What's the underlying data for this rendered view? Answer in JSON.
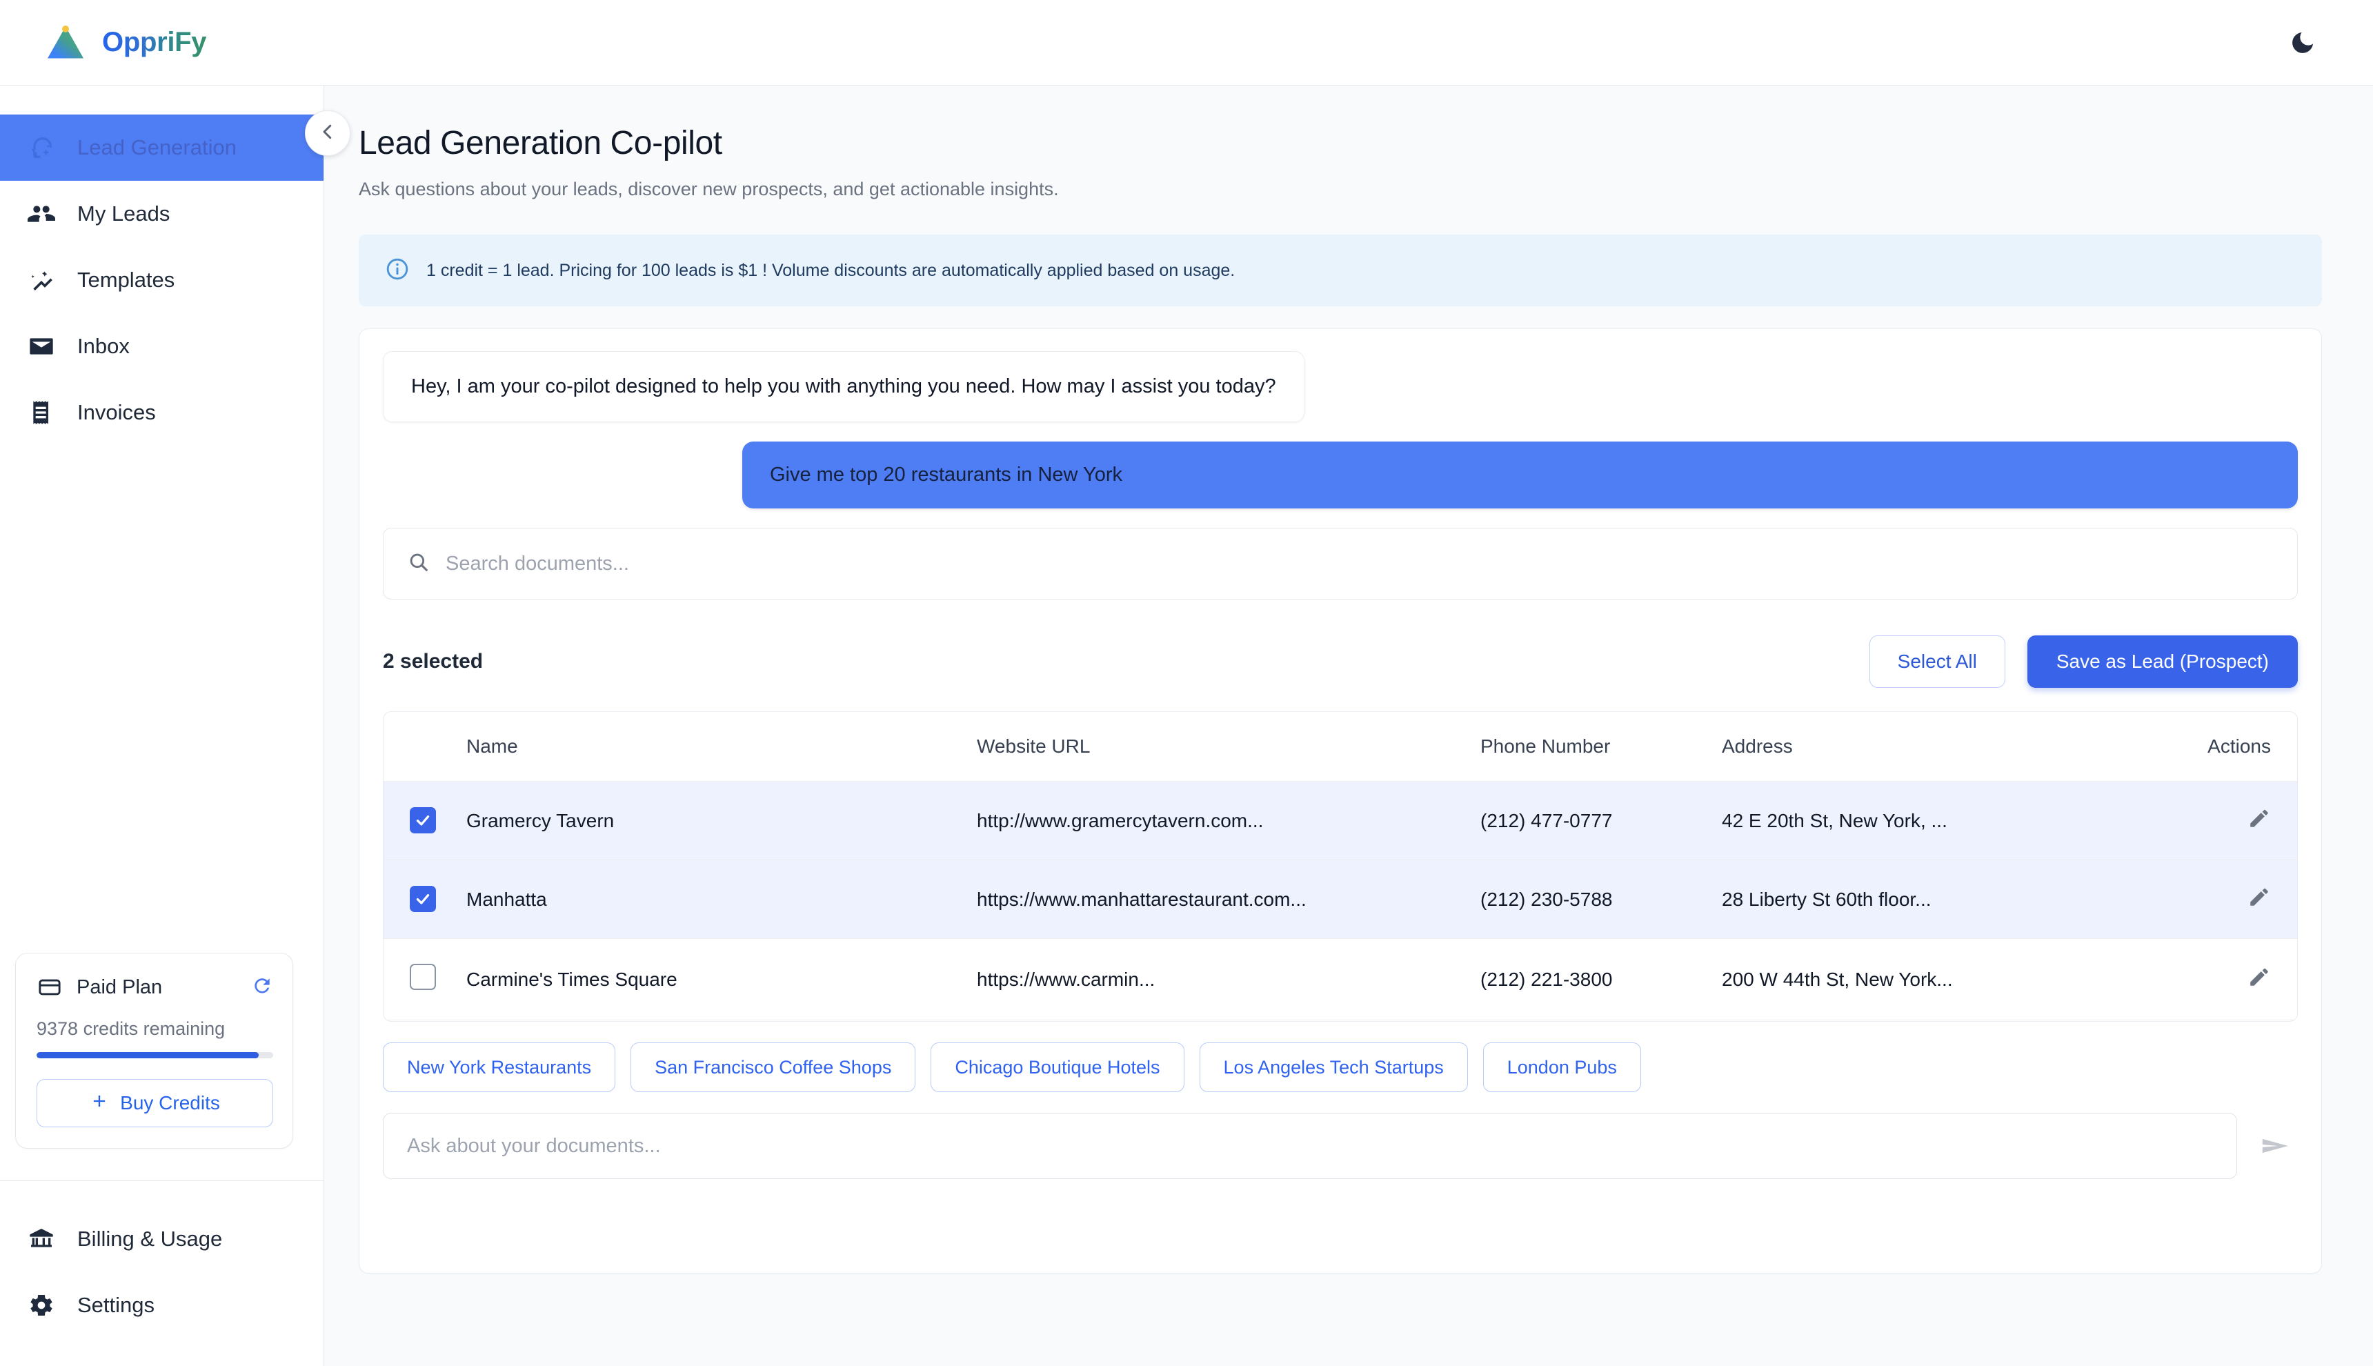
{
  "brand": {
    "name": "OppriFy",
    "logo_icon": "triangle-logo-icon"
  },
  "topbar": {
    "theme_toggle_icon": "moon-icon"
  },
  "sidebar": {
    "collapse_icon": "chevron-left-icon",
    "items": [
      {
        "label": "Lead Generation",
        "icon": "psychology-brain-icon",
        "active": true
      },
      {
        "label": "My Leads",
        "icon": "people-icon",
        "active": false
      },
      {
        "label": "Templates",
        "icon": "sparkle-chart-icon",
        "active": false
      },
      {
        "label": "Inbox",
        "icon": "envelope-icon",
        "active": false
      },
      {
        "label": "Invoices",
        "icon": "receipt-icon",
        "active": false
      }
    ],
    "bottom_items": [
      {
        "label": "Billing & Usage",
        "icon": "bank-icon"
      },
      {
        "label": "Settings",
        "icon": "gear-icon"
      }
    ],
    "plan": {
      "title": "Paid Plan",
      "card_icon": "credit-card-icon",
      "refresh_icon": "refresh-icon",
      "credits_text": "9378 credits remaining",
      "progress_percent": 94,
      "buy_label": "Buy Credits",
      "buy_icon": "plus-icon"
    }
  },
  "main": {
    "title": "Lead Generation Co-pilot",
    "subtitle": "Ask questions about your leads, discover new prospects, and get actionable insights.",
    "info_banner": {
      "icon": "info-circle-icon",
      "text": "1 credit = 1 lead. Pricing for 100 leads is $1 ! Volume discounts are automatically applied based on usage."
    },
    "messages": [
      {
        "role": "bot",
        "text": "Hey, I am your co-pilot designed to help you with anything you need. How may I assist you today?"
      },
      {
        "role": "user",
        "text": "Give me top 20 restaurants in New York"
      }
    ],
    "doc_search": {
      "placeholder": "Search documents...",
      "value": "",
      "icon": "search-icon"
    },
    "selection": {
      "count_label": "2 selected",
      "select_all_label": "Select All",
      "save_label": "Save as Lead (Prospect)"
    },
    "table": {
      "columns": [
        "",
        "Name",
        "Website URL",
        "Phone Number",
        "Address",
        "Actions"
      ],
      "rows": [
        {
          "selected": true,
          "name": "Gramercy Tavern",
          "url": "http://www.gramercytavern.com...",
          "phone": "(212) 477-0777",
          "address": "42 E 20th St, New York, ...",
          "action_icon": "pencil-icon"
        },
        {
          "selected": true,
          "name": "Manhatta",
          "url": "https://www.manhattarestaurant.com...",
          "phone": "(212) 230-5788",
          "address": "28 Liberty St 60th floor...",
          "action_icon": "pencil-icon"
        },
        {
          "selected": false,
          "name": "Carmine's Times Square",
          "url": "https://www.carmin...",
          "phone": "(212) 221-3800",
          "address": "200 W 44th St, New York...",
          "action_icon": "pencil-icon"
        }
      ]
    },
    "suggestions": [
      "New York Restaurants",
      "San Francisco Coffee Shops",
      "Chicago Boutique Hotels",
      "Los Angeles Tech Startups",
      "London Pubs"
    ],
    "compose": {
      "placeholder": "Ask about your documents...",
      "value": "",
      "send_icon": "send-icon"
    }
  },
  "colors": {
    "accent": "#3963e8",
    "active_nav": "#4f7df3",
    "banner_bg": "#e8f3fc",
    "row_selected": "#eef2fe"
  }
}
